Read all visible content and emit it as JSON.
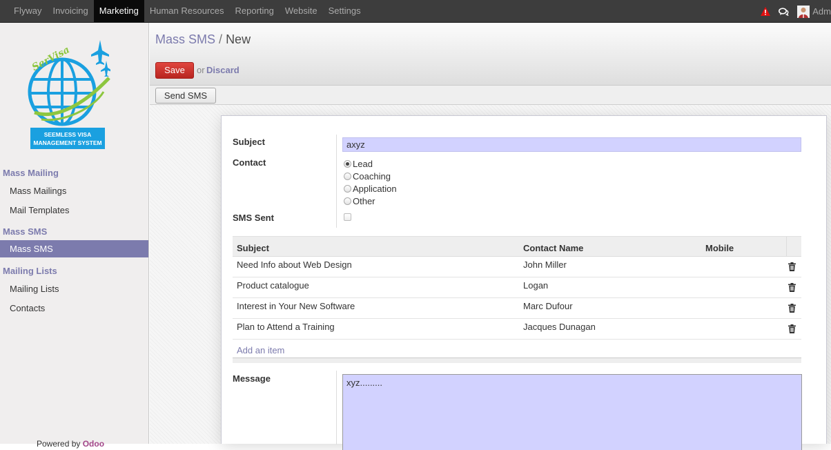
{
  "topbar": {
    "menu": [
      "Flyway",
      "Invoicing",
      "Marketing",
      "Human Resources",
      "Reporting",
      "Website",
      "Settings"
    ],
    "active_index": 2,
    "user_label": "Adm"
  },
  "sidebar": {
    "logo_text": "SerVisa",
    "logo_tagline_1": "SEEMLESS VISA",
    "logo_tagline_2": "MANAGEMENT SYSTEM",
    "sections": [
      {
        "title": "Mass Mailing",
        "items": [
          "Mass Mailings",
          "Mail Templates"
        ]
      },
      {
        "title": "Mass SMS",
        "items": [
          "Mass SMS"
        ]
      },
      {
        "title": "Mailing Lists",
        "items": [
          "Mailing Lists",
          "Contacts"
        ]
      }
    ],
    "active_item": "Mass SMS",
    "powered_by": "Powered by",
    "powered_brand": "Odoo"
  },
  "header": {
    "breadcrumb_parent": "Mass SMS",
    "breadcrumb_sep": "/",
    "breadcrumb_current": "New",
    "save_label": "Save",
    "or_label": "or",
    "discard_label": "Discard"
  },
  "statusbar": {
    "send_label": "Send SMS"
  },
  "form": {
    "subject_label": "Subject",
    "subject_value": "axyz",
    "contact_label": "Contact",
    "contact_options": [
      "Lead",
      "Coaching",
      "Application",
      "Other"
    ],
    "contact_selected": "Lead",
    "sms_sent_label": "SMS Sent",
    "sms_sent_checked": false,
    "table_headers": [
      "Subject",
      "Contact Name",
      "Mobile"
    ],
    "rows": [
      {
        "subject": "Need Info about Web Design",
        "contact": "John Miller",
        "mobile": ""
      },
      {
        "subject": "Product catalogue",
        "contact": "Logan",
        "mobile": ""
      },
      {
        "subject": "Interest in Your New Software",
        "contact": "Marc Dufour",
        "mobile": ""
      },
      {
        "subject": "Plan to Attend a Training",
        "contact": "Jacques Dunagan",
        "mobile": ""
      }
    ],
    "add_item_label": "Add an item",
    "message_label": "Message",
    "message_value": "xyz........."
  },
  "colors": {
    "topbar_bg": "#3d3d3d",
    "accent": "#7c7bad",
    "save_red": "#d3342f",
    "input_bg": "#d2d2ff",
    "alert_red": "#e01010"
  }
}
